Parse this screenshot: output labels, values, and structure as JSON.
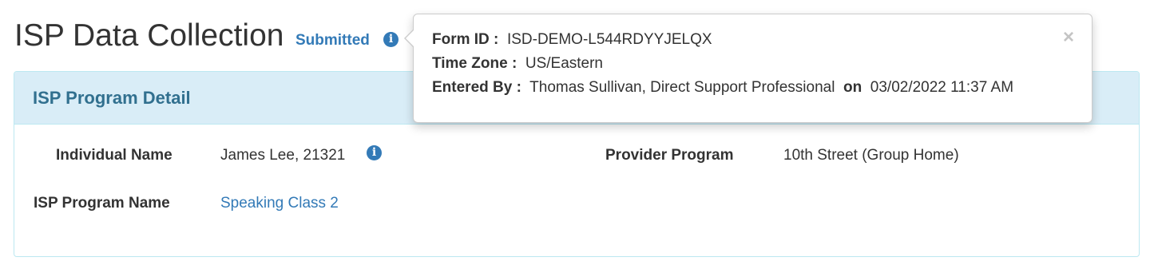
{
  "header": {
    "title": "ISP Data Collection",
    "status": "Submitted",
    "status_icon": "info-icon"
  },
  "panel": {
    "title": "ISP Program Detail",
    "fields": {
      "individual_name_label": "Individual Name",
      "individual_name_value": "James Lee, 21321",
      "provider_program_label": "Provider Program",
      "provider_program_value": "10th Street (Group Home)",
      "isp_program_name_label": "ISP Program Name",
      "isp_program_name_value": "Speaking Class 2"
    }
  },
  "popover": {
    "form_id_label": "Form ID :",
    "form_id_value": "ISD-DEMO-L544RDYYJELQX",
    "time_zone_label": "Time Zone :",
    "time_zone_value": "US/Eastern",
    "entered_by_label": "Entered By :",
    "entered_by_value": "Thomas Sullivan, Direct Support Professional",
    "on_label": "on",
    "entered_on_value": "03/02/2022 11:37 AM",
    "close_symbol": "×"
  },
  "colors": {
    "link": "#337ab7",
    "panel_heading_bg": "#d9edf7",
    "panel_border": "#bce8f1",
    "panel_title": "#31708f"
  }
}
